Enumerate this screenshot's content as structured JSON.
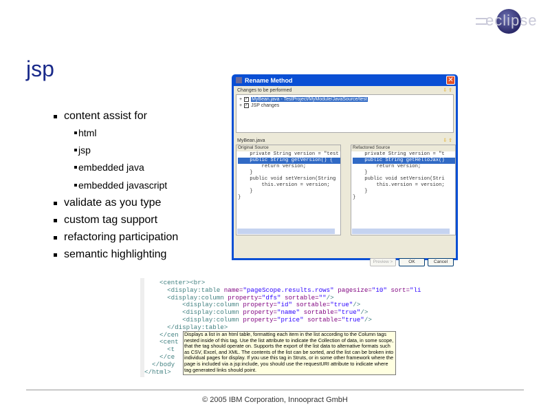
{
  "logo": "eclipse",
  "title": "jsp",
  "bullets": [
    {
      "level": 1,
      "text": "content assist for"
    },
    {
      "level": 2,
      "text": "html"
    },
    {
      "level": 2,
      "text": "jsp"
    },
    {
      "level": 2,
      "text": "embedded java"
    },
    {
      "level": 2,
      "text": "embedded javascript"
    },
    {
      "level": 1,
      "text": "validate as you type"
    },
    {
      "level": 1,
      "text": "custom tag support"
    },
    {
      "level": 1,
      "text": "refactoring participation"
    },
    {
      "level": 1,
      "text": "semantic highlighting"
    }
  ],
  "dialog": {
    "title": "Rename Method",
    "changes_label": "Changes to be performed",
    "tree": [
      "MyBean.java - TestProject/MyModule/JavaSource/test",
      "JSP changes"
    ],
    "file": "MyBean.java",
    "original_label": "Original Source",
    "refactored_label": "Refactored Source",
    "original_code": [
      "    private String version = \"test",
      "",
      "    public String getVersion() {",
      "        return version;",
      "    }",
      "",
      "    public void setVersion(String",
      "        this.version = version;",
      "    }",
      "",
      "",
      "}"
    ],
    "refactored_code": [
      "    private String version = \"t",
      "",
      "    public String getHelloJax()",
      "        return version;",
      "    }",
      "",
      "    public void setVersion(Stri",
      "        this.version = version;",
      "    }",
      "",
      "",
      "}"
    ],
    "buttons": {
      "preview": "Preview >",
      "ok": "OK",
      "cancel": "Cancel"
    }
  },
  "code": [
    [
      [
        "t",
        "    <center><br>"
      ]
    ],
    [
      [
        "t",
        "      <display:table "
      ],
      [
        "a",
        "name="
      ],
      [
        "v",
        "\"pageScope.results.rows\" "
      ],
      [
        "a",
        "pagesize="
      ],
      [
        "v",
        "\"10\" "
      ],
      [
        "a",
        "sort="
      ],
      [
        "v",
        "\"list\""
      ]
    ],
    [
      [
        "t",
        "      <display:column "
      ],
      [
        "a",
        "property="
      ],
      [
        "v",
        "\"dfs\" "
      ],
      [
        "a",
        "sortable="
      ],
      [
        "v",
        "\"\""
      ],
      [
        "t",
        "/>"
      ]
    ],
    [
      [
        "t",
        "          <display:column "
      ],
      [
        "a",
        "property="
      ],
      [
        "v",
        "\"id\" "
      ],
      [
        "a",
        "sortable="
      ],
      [
        "v",
        "\"true\""
      ],
      [
        "t",
        "/>"
      ]
    ],
    [
      [
        "t",
        "          <display:column "
      ],
      [
        "a",
        "property="
      ],
      [
        "v",
        "\"name\" "
      ],
      [
        "a",
        "sortable="
      ],
      [
        "v",
        "\"true\""
      ],
      [
        "t",
        "/>"
      ]
    ],
    [
      [
        "t",
        "          <display:column "
      ],
      [
        "a",
        "property="
      ],
      [
        "v",
        "\"price\" "
      ],
      [
        "a",
        "sortable="
      ],
      [
        "v",
        "\"true\""
      ],
      [
        "t",
        "/>"
      ]
    ],
    [
      [
        "t",
        "      </display:table>"
      ]
    ],
    [
      [
        "t",
        "    </cen"
      ]
    ],
    [
      [
        "t",
        "    <cent"
      ]
    ],
    [
      [
        "t",
        "      <t"
      ]
    ],
    [
      [
        "t",
        "    </ce"
      ]
    ],
    [
      [
        "t",
        "  </body"
      ]
    ],
    [
      [
        "t",
        "</html>"
      ]
    ]
  ],
  "tooltip": "Displays a list in an html table, formatting each item in the list according to the Column tags nested inside of this tag. Use the list attribute to indicate the Collection of data, in some scope, that the tag should operate on. Supports the export of the list data to alternative formats such as CSV, Excel, and XML. The contents of the list can be sorted, and the list can be broken into individual pages for display. If you use this tag in Struts, or in some other framework where the page is included via a jsp:include, you should use the requestURI attribute to indicate where tag generated links should point.",
  "footer": "© 2005 IBM Corporation, Innoopract GmbH"
}
